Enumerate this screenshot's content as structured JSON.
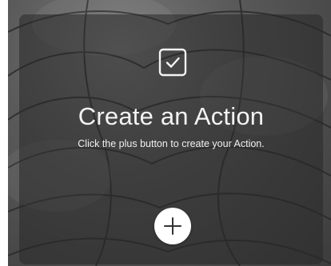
{
  "card": {
    "title": "Create an Action",
    "subtitle": "Click the plus button to create your Action.",
    "header_icon": "checkbox-icon",
    "add_button_icon": "plus-icon"
  },
  "colors": {
    "overlay": "#282828",
    "text": "#f3f3f3",
    "button": "#ffffff",
    "icon_dark": "#333333"
  }
}
